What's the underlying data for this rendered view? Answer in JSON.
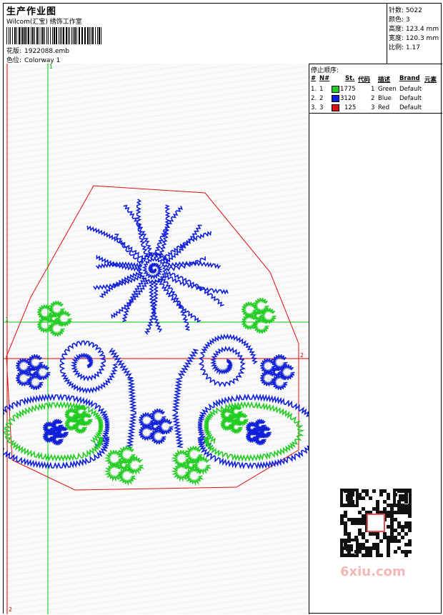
{
  "header": {
    "title": "生产作业图",
    "studio": "Wilcom(汇宝) 绣饰工作室",
    "design_label": "花版:",
    "design_file": "1922088.emb",
    "colorway_label": "色位:",
    "colorway": "Colorway 1"
  },
  "stats": [
    {
      "label": "针数:",
      "value": "5022"
    },
    {
      "label": "颜色:",
      "value": "3"
    },
    {
      "label": "高度:",
      "value": "123.4 mm"
    },
    {
      "label": "宽度:",
      "value": "120.3 mm"
    },
    {
      "label": "比例:",
      "value": "1.17"
    }
  ],
  "stop_sequence": {
    "title": "停止顺序:",
    "columns": [
      "#",
      "N#",
      "St.",
      "代码",
      "描述",
      "Brand",
      "元素"
    ],
    "rows": [
      {
        "idx": "1.",
        "n": "1",
        "color": "#22cc22",
        "stitches": "1775",
        "code": "1",
        "desc": "Green",
        "brand": "Default"
      },
      {
        "idx": "2.",
        "n": "2",
        "color": "#1020d8",
        "stitches": "3120",
        "code": "2",
        "desc": "Blue",
        "brand": "Default"
      },
      {
        "idx": "3.",
        "n": "3",
        "color": "#e01010",
        "stitches": "125",
        "code": "3",
        "desc": "Red",
        "brand": "Default"
      }
    ]
  },
  "guides": {
    "v1": "1",
    "h1": "1",
    "h2": "2",
    "v2": "2"
  },
  "watermark": "6xiu.com"
}
